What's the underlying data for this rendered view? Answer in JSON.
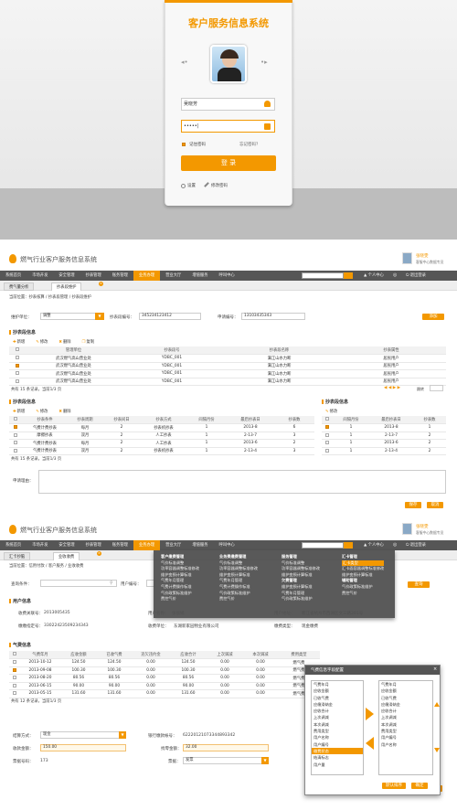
{
  "login": {
    "title": "客户服务信息系统",
    "username": "吴晓芳",
    "password": "•••••|",
    "remember": "记住密码",
    "forgot": "忘记密码？",
    "submit": "登  录",
    "settings": "设置",
    "change_password": "修改密码"
  },
  "app": {
    "title": "燃气行业客户服务信息系统",
    "user_name": "张晓雯",
    "user_dept": "客服中心数据专员",
    "nav": [
      "系统首页",
      "市场开发",
      "安全管理",
      "抄表管理",
      "账务管理",
      "业务办理",
      "营业大厅",
      "增值服务",
      "呼叫中心"
    ],
    "nav_active_page2": "业务办理",
    "nav_active_page3": "业务办理",
    "personal": "个人中心",
    "logout": "退出登录"
  },
  "page2": {
    "tabs": [
      "费气量分析",
      "抄表段维护"
    ],
    "breadcrumb": "当前位置：抄表核算 / 抄表段管理 / 抄表段维护",
    "filter": {
      "dept_label": "维护单位：",
      "dept_value": "调整",
      "book_label": "抄表段编号：",
      "book_value": "345234123412",
      "apply_label": "申请编号：",
      "apply_value": "13103435343",
      "submit": "添加"
    },
    "section1": "抄表段信息",
    "toolbar1": [
      "新增",
      "修改",
      "删除",
      "复制"
    ],
    "table1_headers": [
      "",
      "管理单位",
      "抄表段号",
      "抄表段名称",
      "抄表属性"
    ],
    "table1_rows": [
      [
        "",
        "武汉燃气高山营业处",
        "YDBC_001",
        "满江山水力断",
        "居民用户"
      ],
      [
        "on",
        "武汉燃气高山营业处",
        "YDBC_001",
        "满江山水力断",
        "居民用户"
      ],
      [
        "",
        "武汉燃气高山营业处",
        "YDBC_001",
        "满江山水力断",
        "居民用户"
      ],
      [
        "",
        "武汉燃气高山营业处",
        "YDBC_001",
        "满江山水力断",
        "居民用户"
      ]
    ],
    "pager1": "共有 15 条记录，当前1/3 页",
    "pager1_right": "跳转",
    "section2": "抄表段信息",
    "toolbar2": [
      "新增",
      "修改",
      "删除"
    ],
    "table2_headers": [
      "",
      "抄表条件",
      "抄表周期",
      "抄表间日",
      "抄表方式",
      "间隔月份",
      "最后抄表日",
      "抄表数"
    ],
    "table2_rows": [
      [
        "on",
        "气费计费抄表",
        "每月",
        "2",
        "抄表机抄表",
        "1",
        "2013-8",
        "6"
      ],
      [
        "",
        "摩擦抄表",
        "双月",
        "2",
        "人工抄表",
        "1",
        "2-13-7",
        "3"
      ],
      [
        "",
        "气费计费抄表",
        "每月",
        "2",
        "人工抄表",
        "1",
        "2013-6",
        "2"
      ],
      [
        "",
        "气费计费抄表",
        "双月",
        "2",
        "抄表机抄表",
        "1",
        "2-13-4",
        "3"
      ]
    ],
    "pager2": "共有 15 条记录，当前1/3 页",
    "section3": "抄表段信息",
    "toolbar3": [
      "修改"
    ],
    "table3_headers": [
      "",
      "间隔月份",
      "最后抄表日",
      "抄表数"
    ],
    "table3_rows": [
      [
        "on",
        "1",
        "2013-8",
        "1"
      ],
      [
        "",
        "1",
        "2-13-7",
        "2"
      ],
      [
        "",
        "1",
        "2013-6",
        "2"
      ],
      [
        "",
        "1",
        "2-13-4",
        "2"
      ]
    ],
    "apply_reason_label": "申请理由：",
    "buttons": [
      "保存",
      "取消"
    ]
  },
  "page3": {
    "tabs": [
      "汇卡抄脑",
      "业收收费"
    ],
    "breadcrumb": "当前位置：信用付款 / 客户服务 / 业收收费",
    "search_label": "查询条件：",
    "user_no_label": "用户编号：",
    "search_btn": "查询",
    "user_section": "用户信息",
    "user_info": {
      "user_no_label": "收费关联号：",
      "user_no": "2013005435",
      "name_label": "用户名称：",
      "name": "张丽娟",
      "addr_label": "用户地址：",
      "addr": "新江省杭州市西湖区文三路201号",
      "bank_label": "缴缴指定号：",
      "bank": "33022423509234343",
      "unit_label": "收费单位：",
      "unit": "东湖新家园物业有限公司",
      "type_label": "缴费类型：",
      "type": "现金缴费"
    },
    "fee_section": "气费信息",
    "fee_headers": [
      "",
      "气费年月",
      "应收金额",
      "已收气费",
      "违欠违约金",
      "应收合计",
      "上次调减",
      "本次调减",
      "费用类型"
    ],
    "fee_rows": [
      [
        "",
        "2013-10-12",
        "124.50",
        "124.50",
        "0.00",
        "124.50",
        "0.00",
        "0.00",
        "燃气费"
      ],
      [
        "on",
        "2013-09-08",
        "100.30",
        "100.30",
        "0.00",
        "100.30",
        "0.00",
        "0.00",
        "燃气费"
      ],
      [
        "",
        "2013-08-20",
        "80.56",
        "80.56",
        "0.00",
        "80.56",
        "0.00",
        "0.00",
        "燃气费"
      ],
      [
        "",
        "2013-06-15",
        "90.00",
        "90.00",
        "0.00",
        "90.00",
        "0.00",
        "0.00",
        "燃气费"
      ],
      [
        "",
        "2013-05-15",
        "131.60",
        "131.60",
        "0.00",
        "131.60",
        "0.00",
        "0.00",
        "燃气费"
      ]
    ],
    "fee_pager": "共有 12 条记录，当前1/3 页",
    "settle": {
      "method_label": "结算方式：",
      "method": "现金",
      "bank_acct_label": "银行缴款帐号：",
      "bank_acct": "62220121073344893342",
      "paid_label": "收款金额：",
      "paid": "150.00",
      "change_label": "找零金额：",
      "change": "32.00",
      "invoice_label": "票据号码：",
      "invoice": "173",
      "ticket_label": "票据：",
      "ticket": "发票"
    },
    "bottom_buttons": [
      "收费",
      "收费明细",
      "清除",
      "取消"
    ],
    "mega_menu": {
      "cols": [
        {
          "head": "客户缴费管理",
          "items": [
            "气价标准调整",
            "功率容器调整标准修改",
            "维护变损计算标准",
            "气费年月管理",
            "气费计费操作标准",
            "气价政策标准维护",
            "费控气价"
          ]
        },
        {
          "head": "业务费缴费管理",
          "items": [
            "气价标准调整",
            "功率容器调整标准修改",
            "维护变损计算标准",
            "气费年月管理",
            "气费计费操作标准",
            "气价政策标准维护",
            "费控气价"
          ]
        },
        {
          "head": "服务管理",
          "items": [
            "气价标准调整",
            "功率容器调整标准修改",
            "维护变损计算标准"
          ],
          "head2": "欠费管理",
          "items2": [
            "维护变损计算标准",
            "气费年月管理",
            "气价政策标准维护"
          ]
        },
        {
          "head": "汇卡管理",
          "items": [
            "汇卡类型",
            "汇卡面容器调整标准修改",
            "维护变损计算标准"
          ],
          "head2": "辅助管理",
          "items2": [
            "气价政策标准维护",
            "费控气价"
          ]
        }
      ],
      "active_item": "汇卡类型"
    },
    "dialog": {
      "title": "气费信息字段配置",
      "left": [
        "气费年月",
        "应收金额",
        "已收气费",
        "应缴滞纳金",
        "应收合计",
        "上次调减",
        "本次调减",
        "费用类型",
        "用户名称",
        "用户编号",
        "缴费状态",
        "结清标志",
        "用户量"
      ],
      "left_active": "缴费状态",
      "right": [
        "气费年月",
        "应收金额",
        "已收气费",
        "应缴滞纳金",
        "应收合计",
        "上次调减",
        "本次调减",
        "费用类型",
        "用户编号",
        "用户名称"
      ],
      "btn_default": "默认排序",
      "btn_ok": "确定"
    }
  }
}
